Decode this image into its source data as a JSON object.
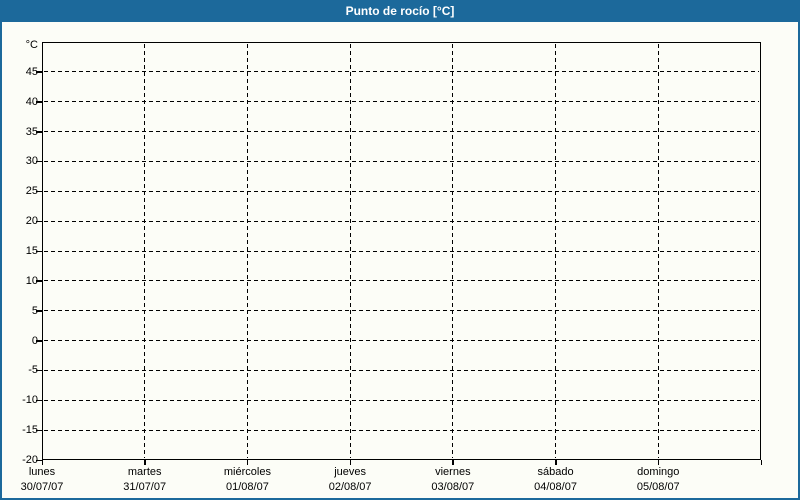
{
  "window": {
    "title": "Punto de rocío [°C]"
  },
  "colors": {
    "titlebar_bg": "#1C699B",
    "titlebar_text": "#FFFFFF",
    "window_border": "#1C699B",
    "content_bg": "#FCFDF7",
    "axis_color": "#000000",
    "grid_color": "#000000",
    "text_color": "#000000"
  },
  "chart_data": {
    "type": "line",
    "title": "Punto de rocío [°C]",
    "y_unit_label": "°C",
    "ylim": [
      -20,
      50
    ],
    "y_tick_step": 5,
    "y_ticks": [
      45,
      40,
      35,
      30,
      25,
      20,
      15,
      10,
      5,
      0,
      -5,
      -10,
      -15,
      -20
    ],
    "x_days": [
      {
        "name": "lunes",
        "date": "30/07/07"
      },
      {
        "name": "martes",
        "date": "31/07/07"
      },
      {
        "name": "miércoles",
        "date": "01/08/07"
      },
      {
        "name": "jueves",
        "date": "02/08/07"
      },
      {
        "name": "viernes",
        "date": "03/08/07"
      },
      {
        "name": "sábado",
        "date": "04/08/07"
      },
      {
        "name": "domingo",
        "date": "05/08/07"
      }
    ],
    "series": [],
    "grid": "dashed",
    "legend": "none"
  }
}
